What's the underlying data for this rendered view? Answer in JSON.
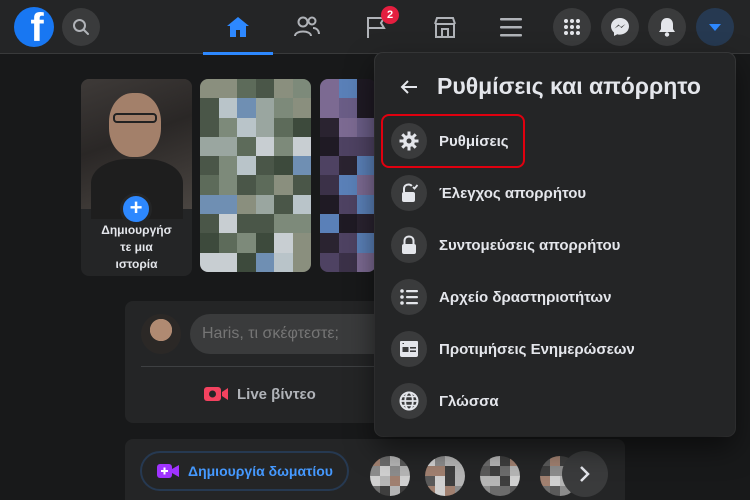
{
  "colors": {
    "accent": "#2d88ff",
    "badge": "#e41e3f",
    "highlight": "#e0000f",
    "live": "#f3425f",
    "room": "#a033ff"
  },
  "topbar": {
    "logo": "f",
    "nav": [
      {
        "name": "home-icon",
        "active": true
      },
      {
        "name": "friends-icon",
        "active": false
      },
      {
        "name": "pages-flag-icon",
        "active": false,
        "badge": "2"
      },
      {
        "name": "marketplace-icon",
        "active": false
      },
      {
        "name": "menu-icon",
        "active": false
      }
    ]
  },
  "stories": {
    "create_label_line1": "Δημιουργήσ",
    "create_label_line2": "τε μια",
    "create_label_line3": "ιστορία"
  },
  "composer": {
    "placeholder": "Haris, τι σκέφτεστε;",
    "live_label": "Live βίντεο"
  },
  "rooms": {
    "create_room_label": "Δημιουργία δωματίου"
  },
  "menu": {
    "title": "Ρυθμίσεις και απόρρητο",
    "items": [
      {
        "label": "Ρυθμίσεις",
        "icon": "gear-icon"
      },
      {
        "label": "Έλεγχος απορρήτου",
        "icon": "lock-check-icon"
      },
      {
        "label": "Συντομεύσεις απορρήτου",
        "icon": "lock-icon"
      },
      {
        "label": "Αρχείο δραστηριοτήτων",
        "icon": "activity-list-icon"
      },
      {
        "label": "Προτιμήσεις Ενημερώσεων",
        "icon": "news-feed-icon"
      },
      {
        "label": "Γλώσσα",
        "icon": "globe-icon"
      }
    ]
  }
}
